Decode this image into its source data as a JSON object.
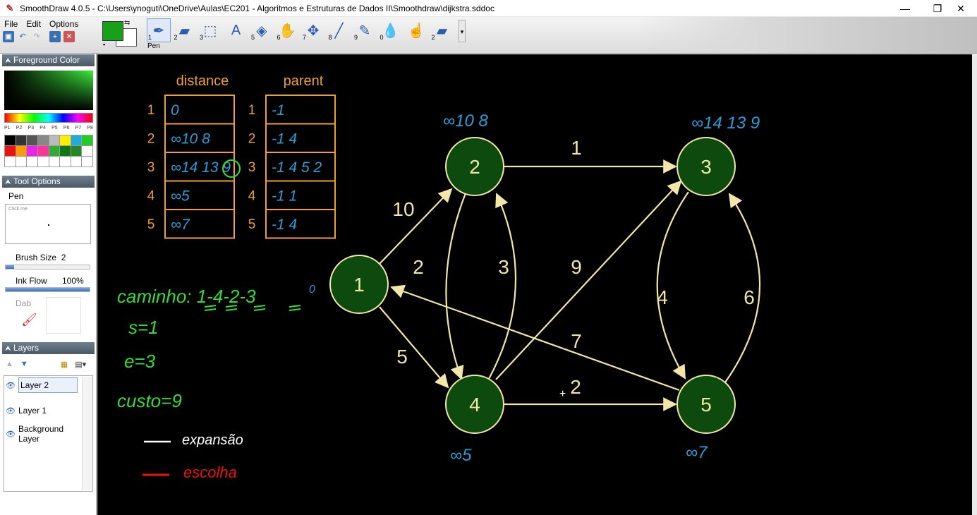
{
  "window": {
    "title": "SmoothDraw 4.0.5 - C:\\Users\\ynoguti\\OneDrive\\Aulas\\EC201 - Algoritmos e Estruturas de Dados II\\Smoothdraw\\dijkstra.sddoc",
    "minimize": "—",
    "restore": "❐",
    "close": "✕"
  },
  "menu": [
    "File",
    "Edit",
    "Options"
  ],
  "toolbar": {
    "selected_tool_label": "Pen",
    "tools": [
      {
        "num": "1",
        "icon": "pen-icon",
        "glyph": "✒"
      },
      {
        "num": "2",
        "icon": "eraser-icon",
        "glyph": "▰"
      },
      {
        "num": "3",
        "icon": "select-icon",
        "glyph": "⬚"
      },
      {
        "num": "",
        "icon": "text-icon",
        "glyph": "A"
      },
      {
        "num": "5",
        "icon": "fill-icon",
        "glyph": "◈"
      },
      {
        "num": "6",
        "icon": "hand-icon",
        "glyph": "✋"
      },
      {
        "num": "7",
        "icon": "move-icon",
        "glyph": "✥"
      },
      {
        "num": "8",
        "icon": "brush-icon",
        "glyph": "╱"
      },
      {
        "num": "9",
        "icon": "airbrush-icon",
        "glyph": "✎"
      },
      {
        "num": "0",
        "icon": "water-icon",
        "glyph": "💧"
      },
      {
        "num": "",
        "icon": "finger-icon",
        "glyph": "☝"
      },
      {
        "num": "2",
        "icon": "eraser2-icon",
        "glyph": "▰"
      }
    ],
    "fg_color": "#19a019",
    "bg_color": "#ffffff"
  },
  "panels": {
    "foreground_color": {
      "header": "Foreground Color",
      "presets": [
        "P1",
        "P2",
        "P3",
        "P4",
        "P5",
        "P6",
        "P7",
        "P8"
      ],
      "palette": [
        "#000000",
        "#333333",
        "#555555",
        "#888888",
        "#bbbbbb",
        "#ffee00",
        "#22aadd",
        "#22cc22",
        "#ee1111",
        "#ff9900",
        "#ee22ee",
        "#ff3399",
        "#33aa33",
        "#117711",
        "#228822",
        "#ffffff",
        "#ffffff",
        "#ffffff",
        "#ffffff",
        "#ffffff",
        "#ffffff",
        "#ffffff",
        "#ffffff",
        "#ffffff"
      ]
    },
    "tool_options": {
      "header": "Tool Options",
      "tool": "Pen",
      "preview_hint": "Click me",
      "brush_size_label": "Brush Size",
      "brush_size_value": "2",
      "brush_size_fraction": 0.1,
      "ink_flow_label": "Ink Flow",
      "ink_flow_value": "100%",
      "ink_flow_fraction": 1.0,
      "dab_label": "Dab"
    },
    "layers": {
      "header": "Layers",
      "items": [
        {
          "name": "Layer 2",
          "active": true
        },
        {
          "name": "Layer 1",
          "active": false
        },
        {
          "name": "Background Layer",
          "active": false
        }
      ]
    }
  },
  "canvas": {
    "tables": {
      "distance_header": "distance",
      "parent_header": "parent",
      "row_labels": [
        "1",
        "2",
        "3",
        "4",
        "5"
      ],
      "distance_values": [
        "0",
        "∞10 8",
        "∞14 13 9",
        "∞5",
        "∞7"
      ],
      "parent_values": [
        "-1",
        "-1 4",
        "-1 4 5 2",
        "-1 1",
        "-1 4"
      ]
    },
    "graph": {
      "nodes": [
        {
          "id": "1",
          "label": "1"
        },
        {
          "id": "2",
          "label": "2"
        },
        {
          "id": "3",
          "label": "3"
        },
        {
          "id": "4",
          "label": "4"
        },
        {
          "id": "5",
          "label": "5"
        }
      ],
      "edges": [
        {
          "from": "1",
          "to": "2",
          "weight": "10"
        },
        {
          "from": "1",
          "to": "4",
          "weight": "5"
        },
        {
          "from": "2",
          "to": "3",
          "weight": "1"
        },
        {
          "from": "2",
          "to": "4",
          "weight": "2"
        },
        {
          "from": "4",
          "to": "2",
          "weight": "3"
        },
        {
          "from": "4",
          "to": "3",
          "weight": "9"
        },
        {
          "from": "4",
          "to": "5",
          "weight": "2"
        },
        {
          "from": "5",
          "to": "1",
          "weight": "7"
        },
        {
          "from": "3",
          "to": "5",
          "weight": "4"
        },
        {
          "from": "5",
          "to": "3",
          "weight": "6"
        }
      ],
      "node_annotations": {
        "2": "∞10 8",
        "3": "∞14 13 9",
        "4": "∞5",
        "5": "∞7"
      },
      "node1_annotation": "0"
    },
    "notes": {
      "path": "caminho: 1-4-2-3",
      "source": "s=1",
      "end": "e=3",
      "cost": "custo=9",
      "legend_white": "expansão",
      "legend_red": "escolha"
    },
    "colors": {
      "table": "#f0a030",
      "node_fill": "#0d4a0d",
      "node_stroke": "#f2e6a8",
      "edge": "#f2e6a8",
      "ink_blue": "#2a9fd8",
      "ink_green": "#33dd33",
      "ink_red": "#ee1111"
    }
  }
}
